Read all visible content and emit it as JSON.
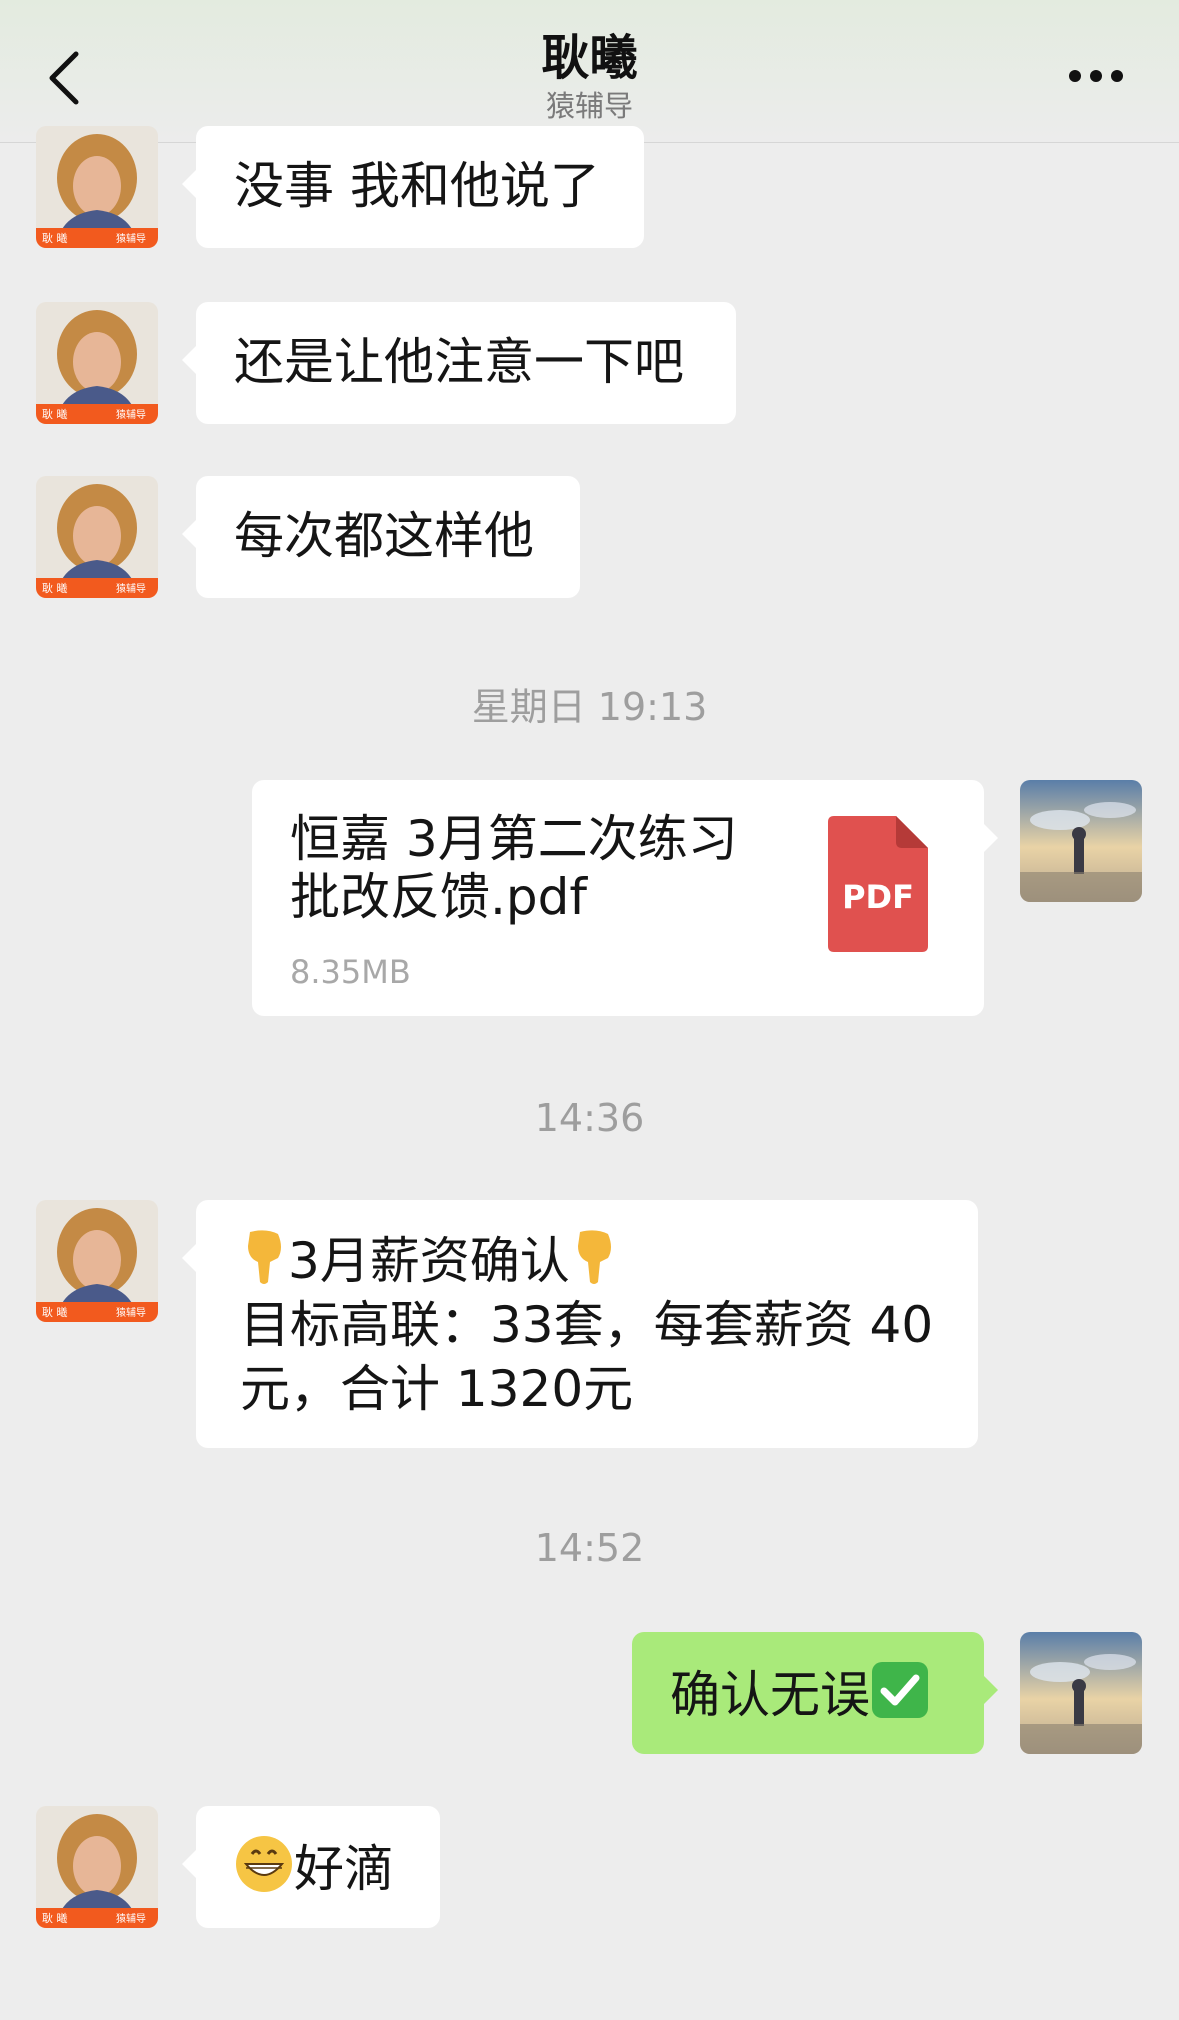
{
  "header": {
    "title": "耿曦",
    "subtitle": "猿辅导"
  },
  "messages": [
    {
      "text": "没事 我和他说了"
    },
    {
      "text": "还是让他注意一下吧"
    },
    {
      "text": "每次都这样他"
    }
  ],
  "timestamps": [
    "星期日 19:13",
    "14:36",
    "14:52"
  ],
  "file": {
    "name_line1": "恒嘉 3月第二次练习",
    "name_line2": "批改反馈.pdf",
    "size": "8.35MB",
    "icon_label": "PDF"
  },
  "salary_message": {
    "title": "3月薪资确认",
    "line2": "目标高联：33套，每套薪资 40",
    "line3": "元，合计 1320元"
  },
  "reply": {
    "text": "确认无误"
  },
  "last_message": {
    "text": "好滴"
  },
  "avatar_badge": {
    "name": "耿 曦",
    "brand": "猿辅导"
  },
  "colors": {
    "background": "#ededed",
    "bubble_white": "#ffffff",
    "bubble_green": "#a9ea7a",
    "pdf_red": "#e0514f",
    "badge_orange": "#f25a1e"
  }
}
